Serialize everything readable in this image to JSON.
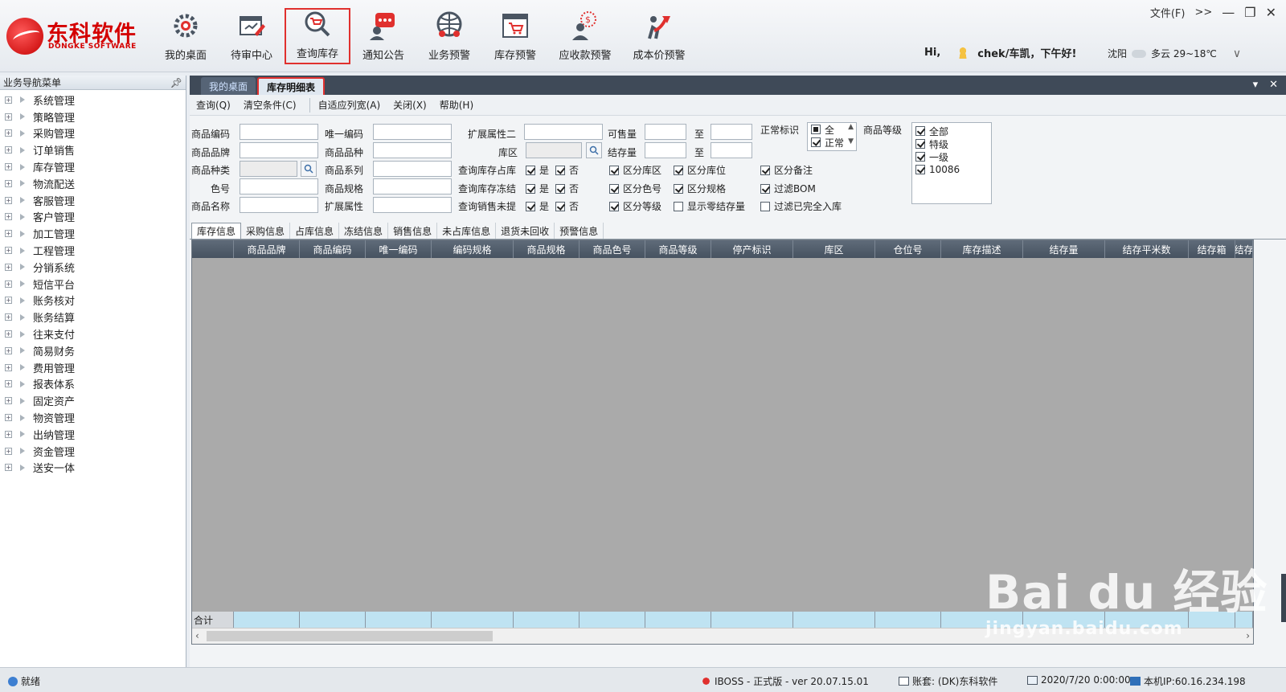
{
  "brand": {
    "name_cn": "东科软件",
    "name_en": "DONGKE SOFTWARE",
    "color": "#d40000"
  },
  "toolbar": [
    {
      "label": "我的桌面",
      "icon": "gear-desktop-icon",
      "active": false
    },
    {
      "label": "待审中心",
      "icon": "review-pen-icon",
      "active": false
    },
    {
      "label": "查询库存",
      "icon": "cart-search-icon",
      "active": true
    },
    {
      "label": "通知公告",
      "icon": "announcement-icon",
      "active": false
    },
    {
      "label": "业务预警",
      "icon": "globe-people-icon",
      "active": false
    },
    {
      "label": "库存预警",
      "icon": "cart-window-icon",
      "active": false
    },
    {
      "label": "应收款预警",
      "icon": "money-user-icon",
      "active": false
    },
    {
      "label": "成本价预警",
      "icon": "trend-arrow-icon",
      "active": false
    }
  ],
  "window": {
    "file_menu": "文件(F)",
    "more": ">>"
  },
  "greeting": {
    "hi": "Hi,",
    "user": "chek/车凯，下午好!"
  },
  "weather": {
    "city": "沈阳",
    "desc": "多云 29~18℃"
  },
  "sidebar": {
    "title": "业务导航菜单",
    "pin": "ᛘ",
    "items": [
      "系统管理",
      "策略管理",
      "采购管理",
      "订单销售",
      "库存管理",
      "物流配送",
      "客服管理",
      "客户管理",
      "加工管理",
      "工程管理",
      "分销系统",
      "短信平台",
      "账务核对",
      "账务结算",
      "往来支付",
      "简易财务",
      "费用管理",
      "报表体系",
      "固定资产",
      "物资管理",
      "出纳管理",
      "资金管理",
      "送安一体"
    ]
  },
  "tabs": [
    {
      "label": "我的桌面",
      "active": false
    },
    {
      "label": "库存明细表",
      "active": true
    }
  ],
  "menu": [
    "查询(Q)",
    "清空条件(C)",
    "自适应列宽(A)",
    "关闭(X)",
    "帮助(H)"
  ],
  "filters": {
    "labels": {
      "product_code": "商品编码",
      "product_brand": "商品品牌",
      "product_type": "商品种类",
      "color_no": "色号",
      "product_name": "商品名称",
      "unique_code": "唯一编码",
      "product_variety": "商品品种",
      "product_series": "商品系列",
      "product_spec": "商品规格",
      "ext_attr": "扩展属性",
      "ext_attr2": "扩展属性二",
      "area": "库区",
      "q_occupy": "查询库存占库",
      "q_freeze": "查询库存冻结",
      "q_sales": "查询销售未提",
      "sellable": "可售量",
      "stock": "结存量",
      "to": "至",
      "normal_flag": "正常标识",
      "grade": "商品等级"
    },
    "yes": "是",
    "no": "否",
    "options": {
      "by_area": "区分库区",
      "by_location": "区分库位",
      "by_remark": "区分备注",
      "by_color": "区分色号",
      "by_spec": "区分规格",
      "filter_bom": "过滤BOM",
      "by_grade": "区分等级",
      "show_zero": "显示零结存量",
      "filter_done": "过滤已完全入库"
    },
    "normal_list": [
      "全",
      "正常"
    ],
    "grade_list": [
      "全部",
      "特级",
      "一级",
      "10086"
    ]
  },
  "subtabs": [
    "库存信息",
    "采购信息",
    "占库信息",
    "冻结信息",
    "销售信息",
    "未占库信息",
    "退货未回收",
    "预警信息"
  ],
  "grid": {
    "columns": [
      "",
      "商品品牌",
      "商品编码",
      "唯一编码",
      "编码规格",
      "商品规格",
      "商品色号",
      "商品等级",
      "停产标识",
      "库区",
      "仓位号",
      "库存描述",
      "结存量",
      "结存平米数",
      "结存箱",
      "结存"
    ],
    "footer_label": "合计"
  },
  "status": {
    "ready": "就绪",
    "version": "IBOSS - 正式版 - ver 20.07.15.01",
    "account": "账套: (DK)东科软件",
    "datetime": "2020/7/20 0:00:00",
    "ip": "本机IP:60.16.234.198"
  },
  "watermark": {
    "main": "Bai du 经验",
    "sub": "jingyan.baidu.com"
  }
}
